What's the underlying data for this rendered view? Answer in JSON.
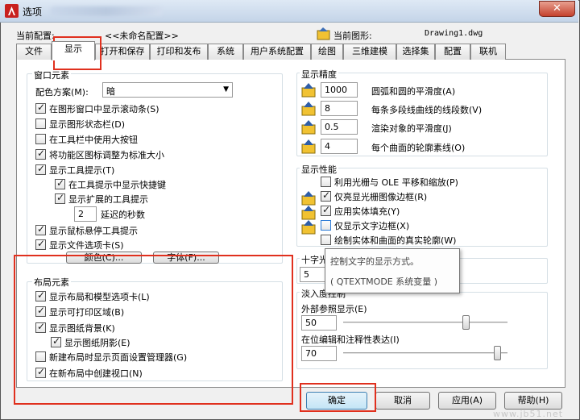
{
  "window": {
    "title": "选项",
    "close_label": "✕"
  },
  "profile": {
    "label": "当前配置:",
    "value": "<<未命名配置>>",
    "drawing_label": "当前图形:",
    "drawing_value": "Drawing1.dwg"
  },
  "tabs": [
    "文件",
    "显示",
    "打开和保存",
    "打印和发布",
    "系统",
    "用户系统配置",
    "绘图",
    "三维建模",
    "选择集",
    "配置",
    "联机"
  ],
  "window_elements": {
    "title": "窗口元素",
    "scheme_label": "配色方案(M):",
    "scheme_value": "暗",
    "options": [
      "在图形窗口中显示滚动条(S)",
      "显示图形状态栏(D)",
      "在工具栏中使用大按钮",
      "将功能区图标调整为标准大小",
      "显示工具提示(T)",
      "在工具提示中显示快捷键",
      "显示扩展的工具提示",
      "延迟的秒数",
      "显示鼠标悬停工具提示",
      "显示文件选项卡(S)"
    ],
    "delay_value": "2",
    "colors_button": "颜色(C)...",
    "fonts_button": "字体(F)..."
  },
  "layout_elements": {
    "title": "布局元素",
    "options": [
      "显示布局和模型选项卡(L)",
      "显示可打印区域(B)",
      "显示图纸背景(K)",
      "显示图纸阴影(E)",
      "新建布局时显示页面设置管理器(G)",
      "在新布局中创建视口(N)"
    ]
  },
  "display_resolution": {
    "title": "显示精度",
    "items": [
      {
        "value": "1000",
        "label": "圆弧和圆的平滑度(A)"
      },
      {
        "value": "8",
        "label": "每条多段线曲线的线段数(V)"
      },
      {
        "value": "0.5",
        "label": "渲染对象的平滑度(J)"
      },
      {
        "value": "4",
        "label": "每个曲面的轮廓素线(O)"
      }
    ]
  },
  "display_performance": {
    "title": "显示性能",
    "options": [
      "利用光栅与 OLE 平移和缩放(P)",
      "仅亮显光栅图像边框(R)",
      "应用实体填充(Y)",
      "仅显示文字边框(X)",
      "绘制实体和曲面的真实轮廓(W)"
    ]
  },
  "crosshair": {
    "title": "十字光",
    "value": "5"
  },
  "fade": {
    "title": "淡入度控制",
    "xref_label": "外部参照显示(E)",
    "xref_value": "50",
    "xref_level": 0.5,
    "inplace_label": "在位编辑和注释性表达(I)",
    "inplace_value": "70",
    "inplace_level": 0.7
  },
  "tooltip": {
    "line1": "控制文字的显示方式。",
    "line2": "( QTEXTMODE 系统变量 )"
  },
  "buttons": {
    "ok": "确定",
    "cancel": "取消",
    "apply": "应用(A)",
    "help": "帮助(H)"
  },
  "watermark": "www.jb51.net",
  "colors": {
    "highlight": "#e0301e",
    "panel_bg": "#ffffff",
    "window_bg": "#f0f0f0"
  }
}
